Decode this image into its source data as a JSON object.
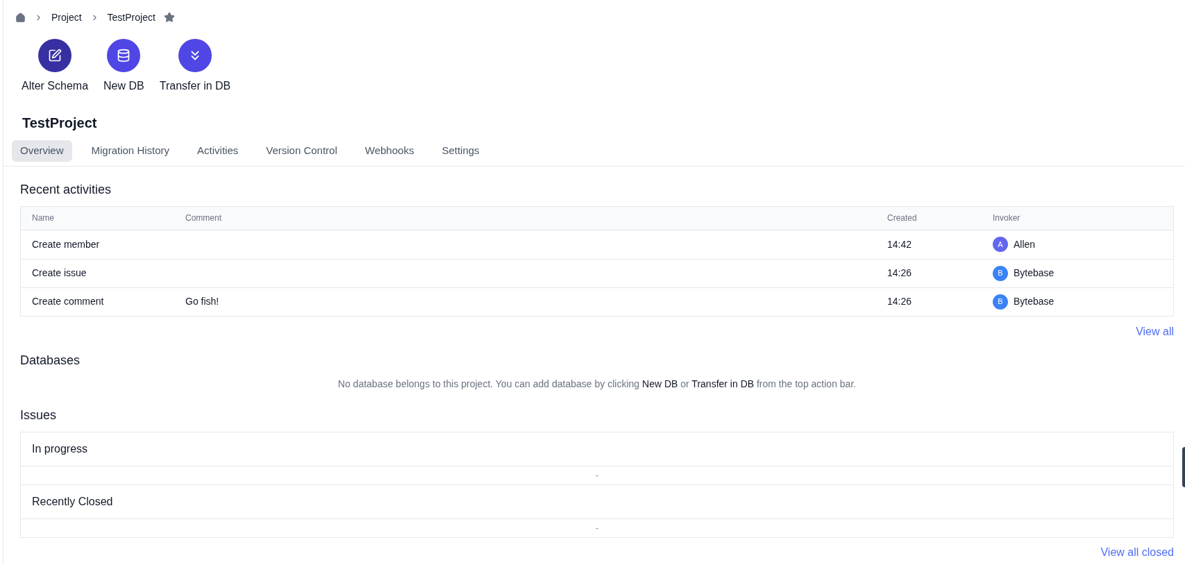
{
  "breadcrumb": {
    "items": [
      "Project",
      "TestProject"
    ],
    "starred": true
  },
  "actions": [
    {
      "label": "Alter Schema",
      "kind": "edit",
      "color": "#3730a3"
    },
    {
      "label": "New DB",
      "kind": "database",
      "color": "#4f46e5"
    },
    {
      "label": "Transfer in DB",
      "kind": "transfer",
      "color": "#4f46e5"
    }
  ],
  "project_title": "TestProject",
  "tabs": [
    {
      "label": "Overview",
      "selected": true
    },
    {
      "label": "Migration History",
      "selected": false
    },
    {
      "label": "Activities",
      "selected": false
    },
    {
      "label": "Version Control",
      "selected": false
    },
    {
      "label": "Webhooks",
      "selected": false
    },
    {
      "label": "Settings",
      "selected": false
    }
  ],
  "recent_activities": {
    "title": "Recent activities",
    "columns": [
      "Name",
      "Comment",
      "Created",
      "Invoker"
    ],
    "rows": [
      {
        "name": "Create member",
        "comment": "",
        "created": "14:42",
        "invoker": {
          "initial": "A",
          "name": "Allen",
          "color": "#6366f1"
        }
      },
      {
        "name": "Create issue",
        "comment": "",
        "created": "14:26",
        "invoker": {
          "initial": "B",
          "name": "Bytebase",
          "color": "#3b82f6"
        }
      },
      {
        "name": "Create comment",
        "comment": "Go fish!",
        "created": "14:26",
        "invoker": {
          "initial": "B",
          "name": "Bytebase",
          "color": "#3b82f6"
        }
      }
    ],
    "view_all": "View all"
  },
  "databases": {
    "title": "Databases",
    "message": [
      {
        "text": "No database belongs to this project. You can add database by clicking ",
        "kind": "plain"
      },
      {
        "text": "New DB",
        "kind": "link"
      },
      {
        "text": " or ",
        "kind": "plain"
      },
      {
        "text": "Transfer in DB",
        "kind": "link"
      },
      {
        "text": " from the top action bar.",
        "kind": "plain"
      }
    ]
  },
  "issues": {
    "title": "Issues",
    "groups": [
      {
        "title": "In progress",
        "empty": "-"
      },
      {
        "title": "Recently Closed",
        "empty": "-"
      }
    ],
    "view_all_closed": "View all closed"
  }
}
